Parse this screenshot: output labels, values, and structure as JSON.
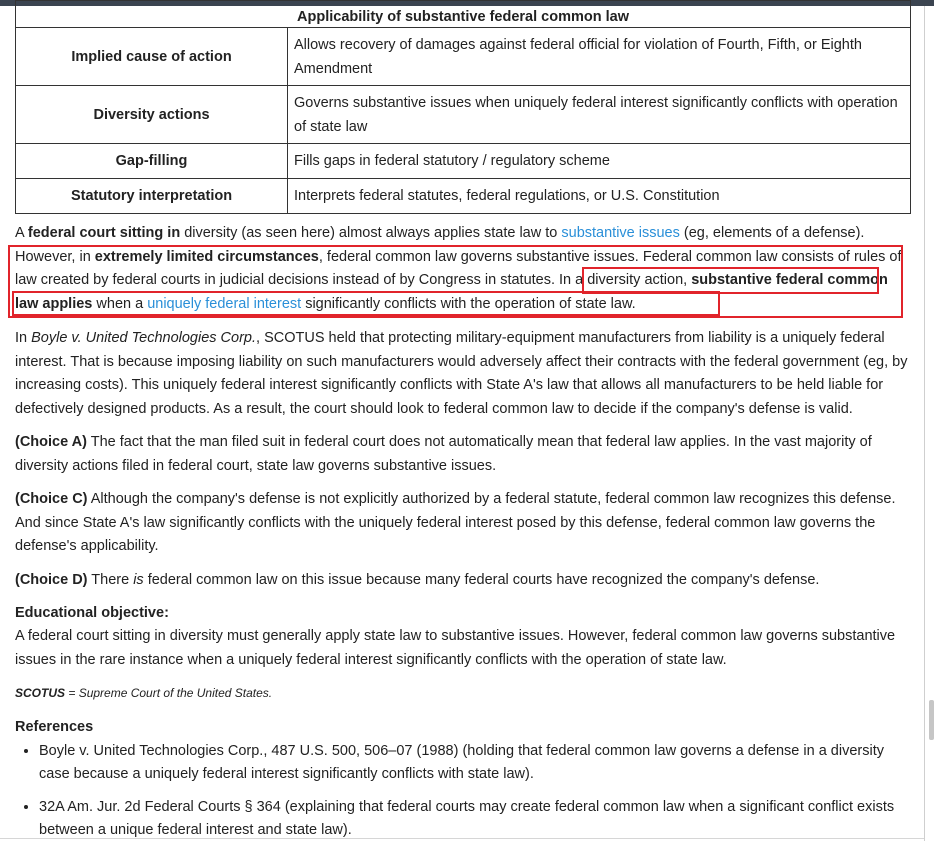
{
  "table": {
    "caption": "Applicability of substantive federal common law",
    "rows": [
      {
        "label": "Implied cause of action",
        "desc": "Allows recovery of damages against federal official for violation of Fourth, Fifth, or Eighth Amendment"
      },
      {
        "label": "Diversity actions",
        "desc": "Governs substantive issues when uniquely federal interest significantly conflicts with operation of state law"
      },
      {
        "label": "Gap-filling",
        "desc": "Fills gaps in federal statutory / regulatory scheme"
      },
      {
        "label": "Statutory interpretation",
        "desc": "Interprets federal statutes, federal regulations, or U.S. Constitution"
      }
    ]
  },
  "para1": {
    "t1": "A ",
    "b1": "federal court sitting in",
    "t2": " diversity (as seen here) almost always applies state law to ",
    "link1": "substantive issues",
    "t3": " (eg, elements of a defense).  However, in ",
    "b2": "extremely limited circumstances",
    "t4": ", federal common law governs substantive issues.  Federal common law consists of rules of law created by federal courts in judicial decisions instead of by Congress in statutes.  In a diversity action, ",
    "b3": "substantive federal common law applies",
    "t5": " when a ",
    "link2": "uniquely federal interest",
    "t6": " significantly conflicts with the operation of state law."
  },
  "para2": {
    "t1": "In ",
    "case": "Boyle v. United Technologies Corp.",
    "t2": ", SCOTUS held that protecting military-equipment manufacturers from liability is a uniquely federal interest.  That is because imposing liability on such manufacturers would adversely affect their contracts with the federal government (eg, by increasing costs).  This uniquely federal interest significantly conflicts with State A's law that allows all manufacturers to be held liable for defectively designed products.  As a result, the court should look to federal common law to decide if the company's defense is valid."
  },
  "choiceA": {
    "label": "(Choice A)",
    "text": " The fact that the man filed suit in federal court does not automatically mean that federal law applies.  In the vast majority of diversity actions filed in federal court, state law governs substantive issues."
  },
  "choiceC": {
    "label": "(Choice C)",
    "text": " Although the company's defense is not explicitly authorized by a federal statute, federal common law recognizes this defense.  And since State A's law significantly conflicts with the uniquely federal interest posed by this defense, federal common law governs the defense's applicability."
  },
  "choiceD": {
    "label": "(Choice D)",
    "t1": " There ",
    "em": "is",
    "t2": " federal common law on this issue because many federal courts have recognized the company's defense."
  },
  "edu": {
    "heading": "Educational objective:",
    "text": "A federal court sitting in diversity must generally apply state law to substantive issues.  However, federal common law governs substantive issues in the rare instance when a uniquely federal interest significantly conflicts with the operation of state law."
  },
  "abbrev": {
    "term": "SCOTUS",
    "def": " = Supreme Court of the United States."
  },
  "references": {
    "heading": "References",
    "items": [
      "Boyle v. United Technologies Corp., 487 U.S. 500, 506–07 (1988) (holding that federal common law governs a defense in a diversity case because a uniquely federal interest significantly conflicts with state law).",
      "32A Am. Jur. 2d Federal Courts § 364 (explaining that federal courts may create federal common law when a significant conflict exists between a unique federal interest and state law)."
    ]
  },
  "colors": {
    "link": "#2a8fd8",
    "highlight_box": "#e1242b",
    "text": "#222222"
  }
}
